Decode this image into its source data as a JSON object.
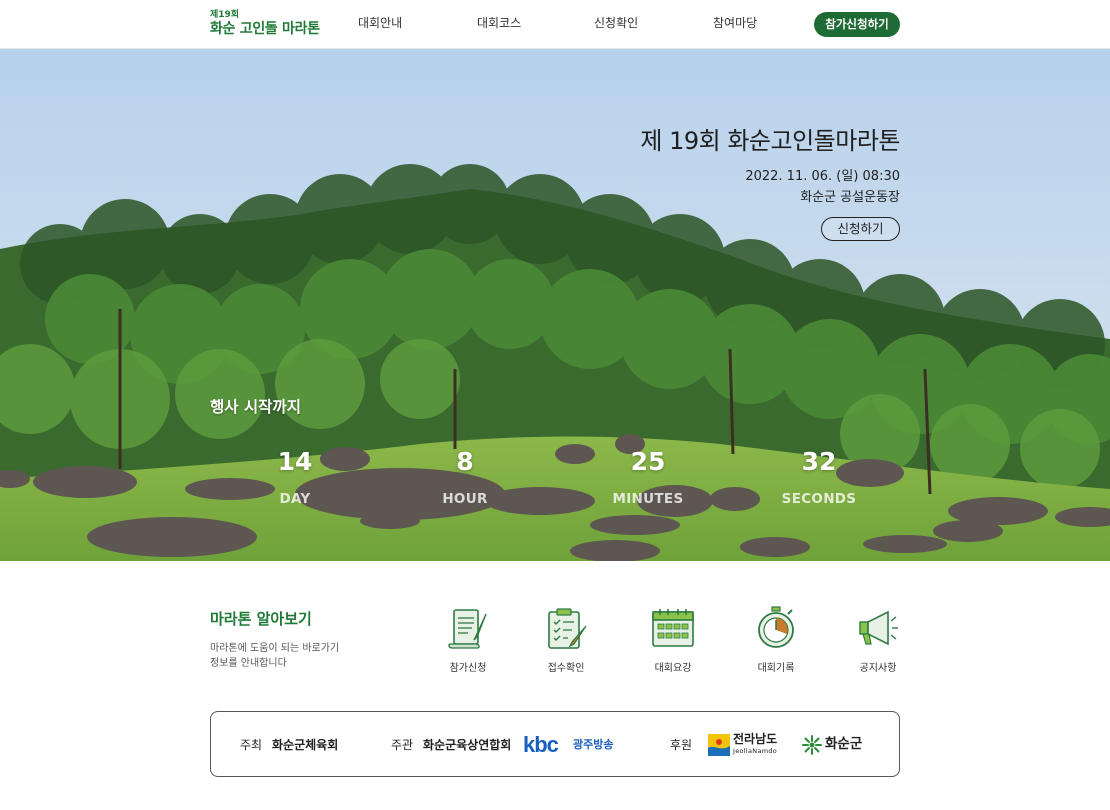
{
  "header": {
    "logo_sup": "제19회",
    "logo_main": "화순 고인돌 마라톤",
    "nav": [
      "대회안내",
      "대회코스",
      "신청확인",
      "참여마당"
    ],
    "apply_label": "참가신청하기"
  },
  "hero": {
    "title": "제 19회 화순고인돌마라톤",
    "date": "2022. 11. 06. (일) 08:30",
    "venue": "화순군 공설운동장",
    "button_label": "신청하기",
    "countdown_title": "행사 시작까지",
    "countdown": [
      {
        "value": "14",
        "unit": "DAY"
      },
      {
        "value": "8",
        "unit": "HOUR"
      },
      {
        "value": "25",
        "unit": "MINUTES"
      },
      {
        "value": "32",
        "unit": "SECONDS"
      }
    ]
  },
  "quick": {
    "title": "마라톤 알아보기",
    "desc_line1": "마라톤에 도움이 되는 바로가기",
    "desc_line2": "정보를 안내합니다",
    "items": [
      {
        "label": "참가신청",
        "icon": "scroll-pen-icon"
      },
      {
        "label": "접수확인",
        "icon": "clipboard-check-icon"
      },
      {
        "label": "대회요강",
        "icon": "calendar-icon"
      },
      {
        "label": "대회기록",
        "icon": "stopwatch-icon"
      },
      {
        "label": "공지사항",
        "icon": "megaphone-icon"
      }
    ]
  },
  "sponsors": {
    "host_label": "주최",
    "host_name": "화순군체육회",
    "organizer_label": "주관",
    "organizer_name": "화순군육상연합회",
    "kbc_logo": "kbc",
    "kbc_name": "광주방송",
    "support_label": "후원",
    "jeonnam_name": "전라남도",
    "jeonnam_sub": "JeollaNamdo",
    "hwasun_name": "화순군"
  },
  "colors": {
    "brand_green": "#1e6b35",
    "kbc_blue": "#1a5fbf"
  }
}
